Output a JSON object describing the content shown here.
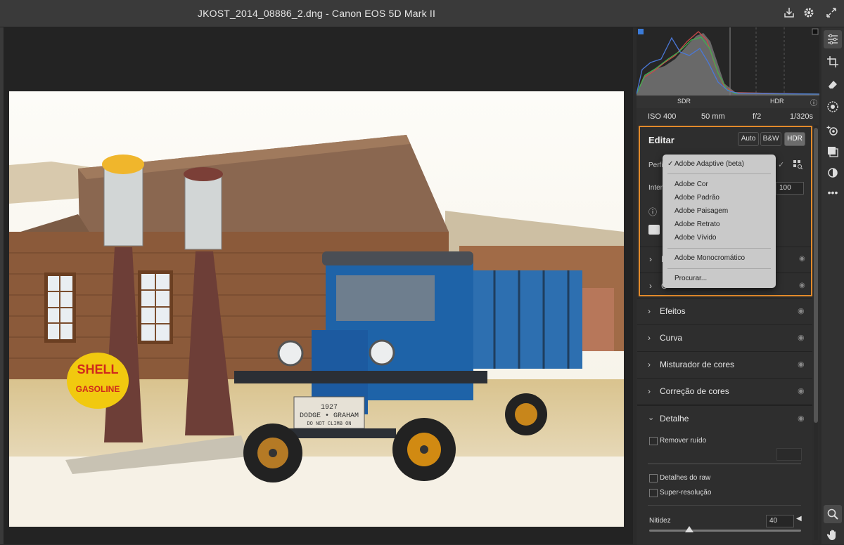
{
  "window": {
    "title": "JKOST_2014_08886_2.dng  -  Canon EOS 5D Mark II"
  },
  "photo": {
    "sign_top": "SHELL",
    "sign_bottom": "GASOLINE",
    "plate_year": "1927",
    "plate_make": "DODGE • GRAHAM",
    "plate_note": "DO NOT CLIMB ON"
  },
  "histogram": {
    "sdr_label": "SDR",
    "hdr_label": "HDR"
  },
  "exif": {
    "iso": "ISO 400",
    "focal": "50 mm",
    "aperture": "f/2",
    "shutter": "1/320s"
  },
  "edit": {
    "title": "Editar",
    "auto_label": "Auto",
    "bw_label": "B&W",
    "hdr_label": "HDR",
    "profile_label_partial": "Perfi",
    "intensity_label_partial": "Inter",
    "intensity_value": "100",
    "collapsed_row1_partial": "L",
    "collapsed_row2_partial": "C"
  },
  "profile_menu": {
    "selected": "Adobe Adaptive (beta)",
    "items": [
      "Adobe Cor",
      "Adobe Padrão",
      "Adobe Paisagem",
      "Adobe Retrato",
      "Adobe Vívido"
    ],
    "mono": "Adobe Monocromático",
    "browse": "Procurar..."
  },
  "sections": [
    {
      "label": "Efeitos"
    },
    {
      "label": "Curva"
    },
    {
      "label": "Misturador de cores"
    },
    {
      "label": "Correção de cores"
    }
  ],
  "detail": {
    "title": "Detalhe",
    "noise_label": "Remover ruído",
    "raw_details_label": "Detalhes do raw",
    "super_res_label": "Super-resolução",
    "sharpness_label": "Nitidez",
    "sharpness_value": "40"
  },
  "icons": [
    "export-icon",
    "gear-icon",
    "fullscreen-icon",
    "edit-sliders-icon",
    "crop-icon",
    "eraser-icon",
    "mask-icon",
    "redeye-icon",
    "presets-icon",
    "snapshot-icon",
    "more-icon",
    "zoom-icon",
    "hand-icon",
    "info-icon",
    "comment-icon",
    "eye-icon",
    "chevron-right-icon",
    "chevron-down-icon",
    "checkmark-icon",
    "grid-search-icon"
  ]
}
